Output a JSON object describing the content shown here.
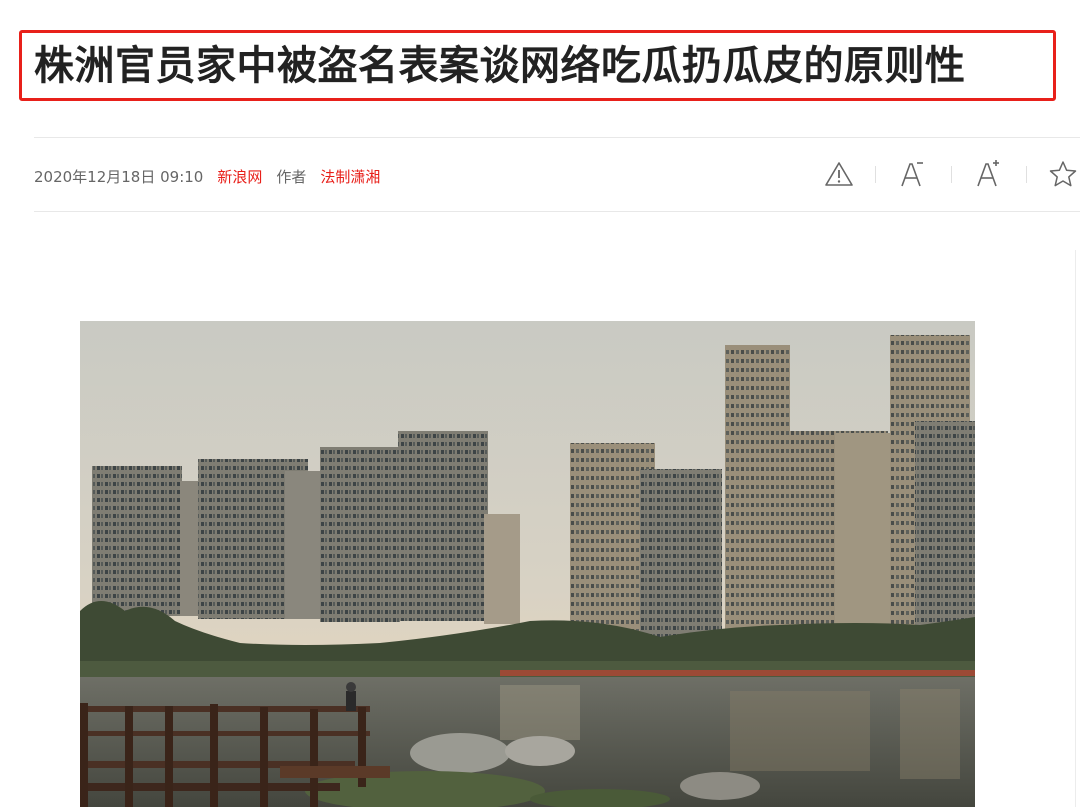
{
  "article": {
    "title": "株洲官员家中被盗名表案谈网络吃瓜扔瓜皮的原则性",
    "date": "2020年12月18日 09:10",
    "source": "新浪网",
    "author_label": "作者",
    "author": "法制潇湘"
  },
  "toolbar": {
    "report_icon": "warning-icon",
    "font_decrease_icon": "font-decrease-icon",
    "font_increase_icon": "font-increase-icon",
    "favorite_icon": "star-icon"
  },
  "colors": {
    "accent": "#e8201a",
    "title": "#222222",
    "meta_text": "#666666",
    "divider": "#e8e8e8"
  }
}
